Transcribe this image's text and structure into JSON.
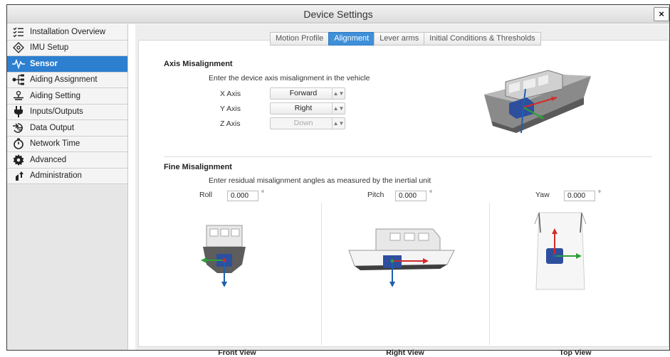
{
  "window": {
    "title": "Device Settings",
    "close_label": "×"
  },
  "sidebar": {
    "items": [
      {
        "label": "Installation Overview",
        "icon": "checklist-icon",
        "active": false
      },
      {
        "label": "IMU Setup",
        "icon": "imu-icon",
        "active": false
      },
      {
        "label": "Sensor",
        "icon": "waveform-icon",
        "active": true
      },
      {
        "label": "Aiding Assignment",
        "icon": "tree-icon",
        "active": false
      },
      {
        "label": "Aiding Setting",
        "icon": "antenna-icon",
        "active": false
      },
      {
        "label": "Inputs/Outputs",
        "icon": "plug-icon",
        "active": false
      },
      {
        "label": "Data Output",
        "icon": "data-output-icon",
        "active": false
      },
      {
        "label": "Network Time",
        "icon": "stopwatch-icon",
        "active": false
      },
      {
        "label": "Advanced",
        "icon": "gear-icon",
        "active": false
      },
      {
        "label": "Administration",
        "icon": "admin-icon",
        "active": false
      }
    ]
  },
  "tabs": [
    {
      "label": "Motion Profile",
      "active": false
    },
    {
      "label": "Alignment",
      "active": true
    },
    {
      "label": "Lever arms",
      "active": false
    },
    {
      "label": "Initial Conditions & Thresholds",
      "active": false
    }
  ],
  "axis_misalignment": {
    "title": "Axis Misalignment",
    "hint": "Enter the device axis misalignment in the vehicle",
    "axes": [
      {
        "label": "X Axis",
        "value": "Forward",
        "disabled": false
      },
      {
        "label": "Y Axis",
        "value": "Right",
        "disabled": false
      },
      {
        "label": "Z Axis",
        "value": "Down",
        "disabled": true
      }
    ]
  },
  "fine_misalignment": {
    "title": "Fine Misalignment",
    "hint": "Enter residual misalignment angles as measured by the inertial unit",
    "degree_symbol": "°",
    "angles": [
      {
        "label": "Roll",
        "value": "0.000"
      },
      {
        "label": "Pitch",
        "value": "0.000"
      },
      {
        "label": "Yaw",
        "value": "0.000"
      }
    ],
    "views": [
      {
        "caption": "Front View"
      },
      {
        "caption": "Right View"
      },
      {
        "caption": "Top View"
      }
    ]
  },
  "colors": {
    "accent": "#2d7fd0",
    "axis_x": "#d32a2a",
    "axis_y": "#2e9e3a",
    "axis_z": "#1f5fae",
    "hull": "#6b6b6b"
  }
}
